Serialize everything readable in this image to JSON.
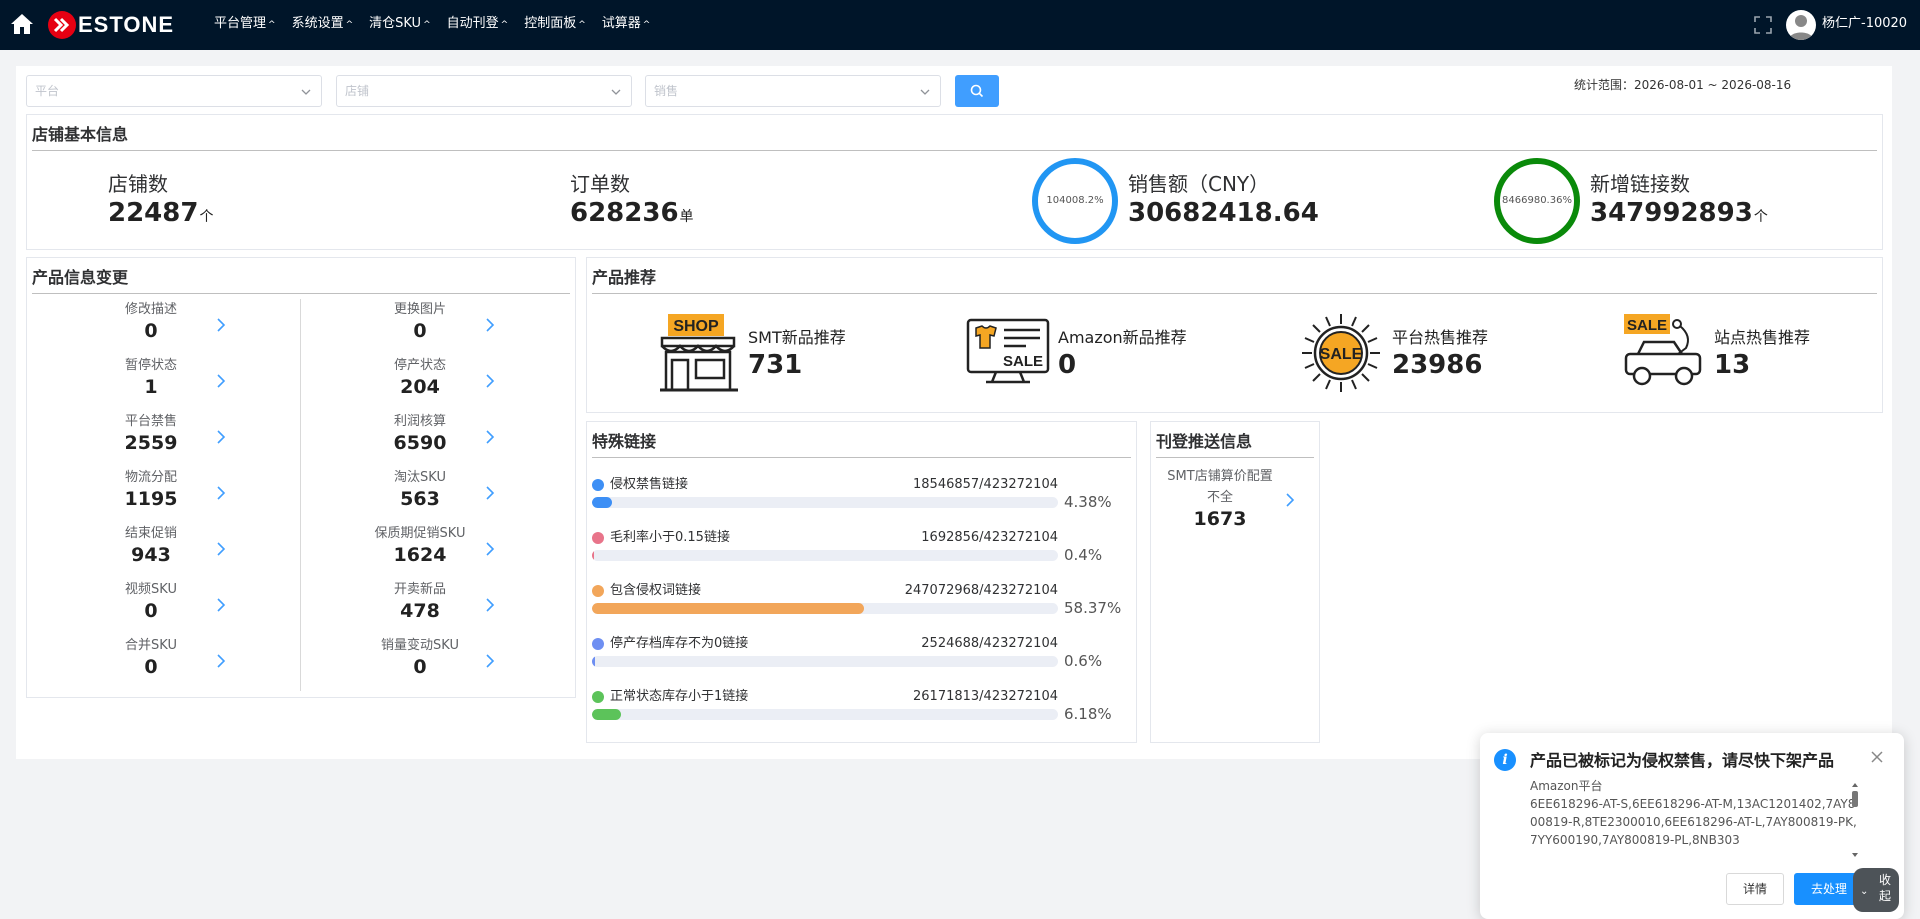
{
  "header": {
    "logo_text": "ESTONE",
    "nav": [
      {
        "label": "平台管理"
      },
      {
        "label": "系统设置"
      },
      {
        "label": "清仓SKU"
      },
      {
        "label": "自动刊登"
      },
      {
        "label": "控制面板"
      },
      {
        "label": "试算器"
      }
    ],
    "user_name": "杨仁广-10020"
  },
  "filters": {
    "platform_placeholder": "平台",
    "store_placeholder": "店铺",
    "sales_placeholder": "销售",
    "date_range": "统计范围：2026-08-01 ~ 2026-08-16"
  },
  "store_info": {
    "title": "店铺基本信息",
    "store_count": {
      "label": "店铺数",
      "value": "22487",
      "unit": "个"
    },
    "order_count": {
      "label": "订单数",
      "value": "628236",
      "unit": "单"
    },
    "sales": {
      "label": "销售额（CNY）",
      "value": "30682418.64",
      "ring_text": "104008.2%",
      "ring_color": "#2196f3"
    },
    "new_links": {
      "label": "新增链接数",
      "value": "347992893",
      "unit": "个",
      "ring_text": "8466980.36%",
      "ring_color": "#0a8a0a"
    }
  },
  "product_changes": {
    "title": "产品信息变更",
    "left": [
      {
        "label": "修改描述",
        "value": "0"
      },
      {
        "label": "暂停状态",
        "value": "1"
      },
      {
        "label": "平台禁售",
        "value": "2559"
      },
      {
        "label": "物流分配",
        "value": "1195"
      },
      {
        "label": "结束促销",
        "value": "943"
      },
      {
        "label": "视频SKU",
        "value": "0"
      },
      {
        "label": "合并SKU",
        "value": "0"
      }
    ],
    "right": [
      {
        "label": "更换图片",
        "value": "0"
      },
      {
        "label": "停产状态",
        "value": "204"
      },
      {
        "label": "利润核算",
        "value": "6590"
      },
      {
        "label": "淘汰SKU",
        "value": "563"
      },
      {
        "label": "保质期促销SKU",
        "value": "1624"
      },
      {
        "label": "开卖新品",
        "value": "478"
      },
      {
        "label": "销量变动SKU",
        "value": "0"
      }
    ]
  },
  "recommendations": {
    "title": "产品推荐",
    "items": [
      {
        "label": "SMT新品推荐",
        "value": "731",
        "icon": "shop-icon",
        "badge": "SHOP"
      },
      {
        "label": "Amazon新品推荐",
        "value": "0",
        "icon": "monitor-sale-icon",
        "badge": "SALE"
      },
      {
        "label": "平台热售推荐",
        "value": "23986",
        "icon": "sale-sun-icon",
        "badge": "SALE"
      },
      {
        "label": "站点热售推荐",
        "value": "13",
        "icon": "car-sale-icon",
        "badge": "SALE"
      }
    ]
  },
  "special_links": {
    "title": "特殊链接",
    "items": [
      {
        "name": "侵权禁售链接",
        "count": "18546857/423272104",
        "pct": "4.38%",
        "fraction": 0.0438,
        "color": "#3d8ff5"
      },
      {
        "name": "毛利率小于0.15链接",
        "count": "1692856/423272104",
        "pct": "0.4%",
        "fraction": 0.004,
        "color": "#e8748a"
      },
      {
        "name": "包含侵权词链接",
        "count": "247072968/423272104",
        "pct": "58.37%",
        "fraction": 0.5837,
        "color": "#f2a65a"
      },
      {
        "name": "停产存档库存不为0链接",
        "count": "2524688/423272104",
        "pct": "0.6%",
        "fraction": 0.006,
        "color": "#6e8ff2"
      },
      {
        "name": "正常状态库存小于1链接",
        "count": "26171813/423272104",
        "pct": "6.18%",
        "fraction": 0.0618,
        "color": "#5cc35a"
      }
    ]
  },
  "publish_push": {
    "title": "刊登推送信息",
    "item_label": "SMT店铺算价配置不全",
    "item_value": "1673"
  },
  "notification": {
    "title": "产品已被标记为侵权禁售，请尽快下架产品",
    "body_title": "Amazon平台",
    "body_text": "6EE618296-AT-S,6EE618296-AT-M,13AC1201402,7AY800819-R,8TE2300010,6EE618296-AT-L,7AY800819-PK,7YY600190,7AY800819-PL,8NB303",
    "detail_label": "详情",
    "handle_label": "去处理",
    "collapse_label": "收起"
  }
}
